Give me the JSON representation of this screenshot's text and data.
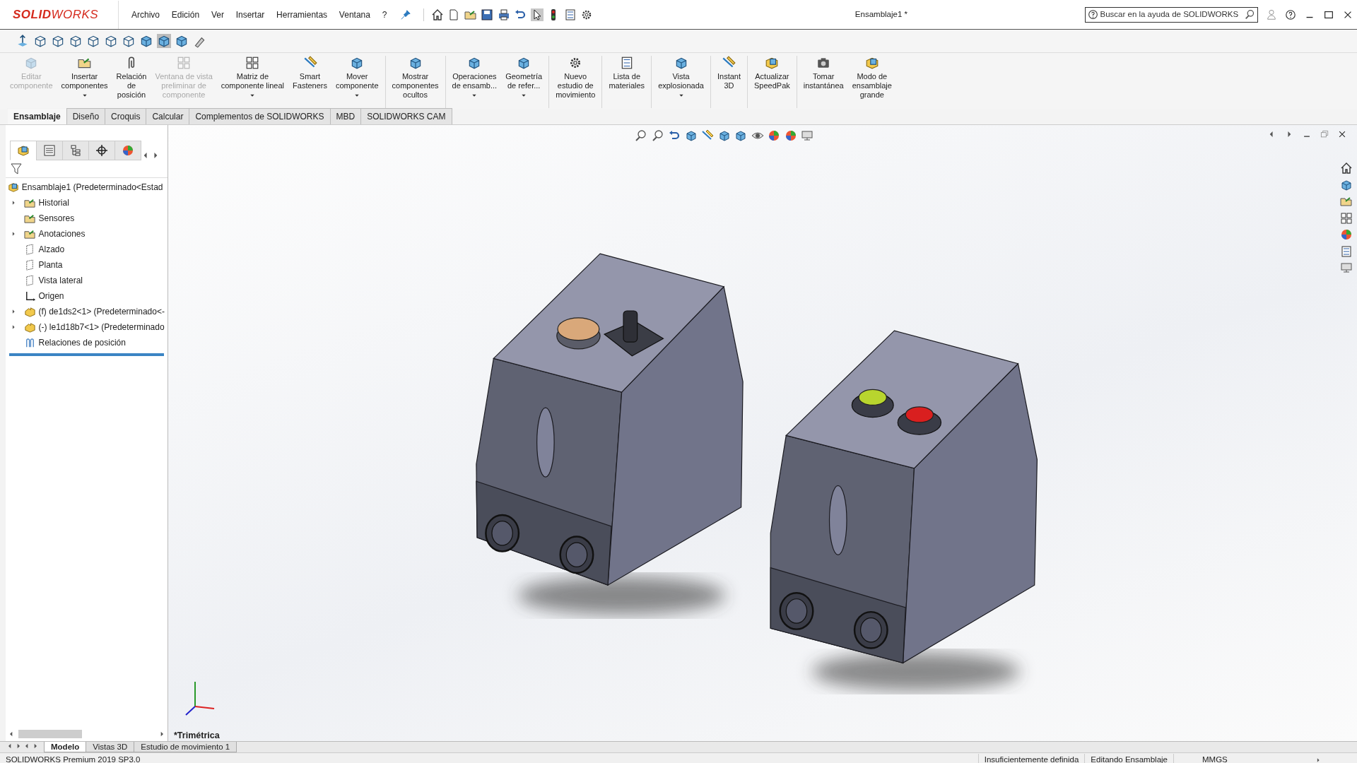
{
  "app": {
    "logo": "**SOLID**WORKS",
    "title": "Ensamblaje1 *",
    "search": {
      "placeholder": "Buscar en la ayuda de SOLIDWORKS"
    }
  },
  "menu": [
    "Archivo",
    "Edición",
    "Ver",
    "Insertar",
    "Herramientas",
    "Ventana",
    "?"
  ],
  "ribbon": [
    {
      "label": "Editar\ncomponente",
      "disabled": true,
      "dropdown": false,
      "separator_after": false
    },
    {
      "label": "Insertar\ncomponentes",
      "disabled": false,
      "dropdown": true,
      "separator_after": false
    },
    {
      "label": "Relación\nde\nposición",
      "disabled": false,
      "dropdown": false,
      "separator_after": false
    },
    {
      "label": "Ventana de vista\npreliminar de\ncomponente",
      "disabled": true,
      "dropdown": false,
      "separator_after": false
    },
    {
      "label": "Matriz de\ncomponente lineal",
      "disabled": false,
      "dropdown": true,
      "separator_after": false
    },
    {
      "label": "Smart\nFasteners",
      "disabled": false,
      "dropdown": false,
      "separator_after": false
    },
    {
      "label": "Mover\ncomponente",
      "disabled": false,
      "dropdown": true,
      "separator_after": true
    },
    {
      "label": "Mostrar\ncomponentes\nocultos",
      "disabled": false,
      "dropdown": false,
      "separator_after": true
    },
    {
      "label": "Operaciones\nde ensamb...",
      "disabled": false,
      "dropdown": true,
      "separator_after": false
    },
    {
      "label": "Geometría\nde refer...",
      "disabled": false,
      "dropdown": true,
      "separator_after": true
    },
    {
      "label": "Nuevo\nestudio de\nmovimiento",
      "disabled": false,
      "dropdown": false,
      "separator_after": true
    },
    {
      "label": "Lista de\nmateriales",
      "disabled": false,
      "dropdown": false,
      "separator_after": true
    },
    {
      "label": "Vista\nexplosionada",
      "disabled": false,
      "dropdown": true,
      "separator_after": true
    },
    {
      "label": "Instant\n3D",
      "disabled": false,
      "dropdown": false,
      "separator_after": true
    },
    {
      "label": "Actualizar\nSpeedPak",
      "disabled": false,
      "dropdown": false,
      "separator_after": true
    },
    {
      "label": "Tomar\ninstantánea",
      "disabled": false,
      "dropdown": false,
      "separator_after": false
    },
    {
      "label": "Modo de\nensamblaje\ngrande",
      "disabled": false,
      "dropdown": false,
      "separator_after": false
    }
  ],
  "command_tabs": [
    {
      "label": "Ensamblaje",
      "selected": true
    },
    {
      "label": "Diseño",
      "selected": false
    },
    {
      "label": "Croquis",
      "selected": false
    },
    {
      "label": "Calcular",
      "selected": false
    },
    {
      "label": "Complementos de SOLIDWORKS",
      "selected": false
    },
    {
      "label": "MBD",
      "selected": false
    },
    {
      "label": "SOLIDWORKS CAM",
      "selected": false
    }
  ],
  "panel_tabs": [
    {
      "selected": true
    },
    {
      "selected": false
    },
    {
      "selected": false
    },
    {
      "selected": false
    },
    {
      "selected": false
    }
  ],
  "tree": {
    "root": "Ensamblaje1  (Predeterminado<Estad",
    "items": [
      {
        "label": "Historial",
        "kind": "folder",
        "expandable": true
      },
      {
        "label": "Sensores",
        "kind": "folder",
        "expandable": false
      },
      {
        "label": "Anotaciones",
        "kind": "folder",
        "expandable": true
      },
      {
        "label": "Alzado",
        "kind": "plane",
        "expandable": false
      },
      {
        "label": "Planta",
        "kind": "plane",
        "expandable": false
      },
      {
        "label": "Vista lateral",
        "kind": "plane",
        "expandable": false
      },
      {
        "label": "Origen",
        "kind": "origin",
        "expandable": false
      },
      {
        "label": "(f) de1ds2<1> (Predeterminado<-",
        "kind": "part",
        "expandable": true
      },
      {
        "label": "(-) le1d18b7<1> (Predeterminado",
        "kind": "part",
        "expandable": true
      },
      {
        "label": "Relaciones de posición",
        "kind": "mates",
        "expandable": false
      }
    ]
  },
  "view": {
    "name": "*Trimétrica"
  },
  "bottom_tabs": [
    {
      "label": "Modelo",
      "selected": true
    },
    {
      "label": "Vistas 3D",
      "selected": false
    },
    {
      "label": "Estudio de movimiento 1",
      "selected": false
    }
  ],
  "status_bar": [
    "SOLIDWORKS Premium 2019 SP3.0",
    "Insuficientemente definida",
    "Editando Ensamblaje",
    "MMGS"
  ]
}
